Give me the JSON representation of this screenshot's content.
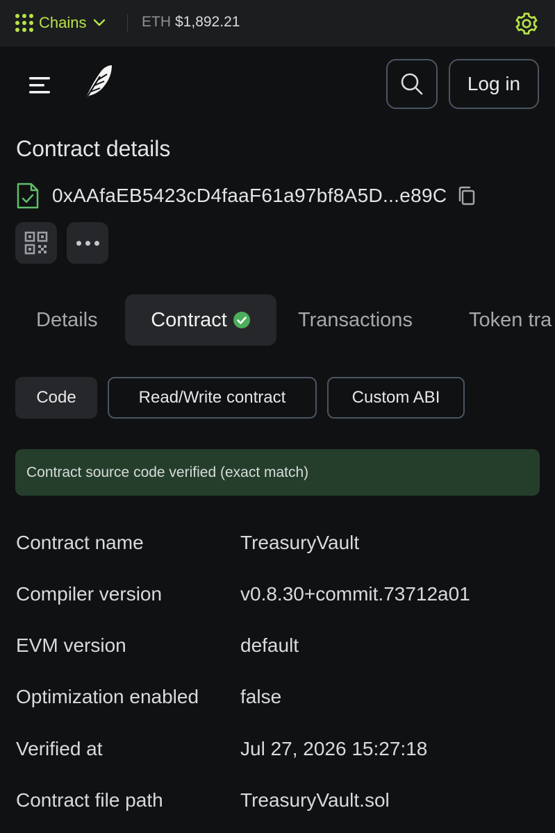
{
  "topbar": {
    "chains_label": "Chains",
    "eth_label": "ETH",
    "eth_price": "$1,892.21",
    "accent_color": "#b7e34a"
  },
  "header": {
    "login_label": "Log in",
    "icons": [
      "menu-icon",
      "feather-logo",
      "search-icon",
      "gear-icon"
    ]
  },
  "page": {
    "title": "Contract details",
    "address": "0xAAfaEB5423cD4faaF61a97bf8A5D...e89C"
  },
  "tabs": [
    {
      "label": "Details"
    },
    {
      "label": "Contract",
      "active": true
    },
    {
      "label": "Transactions"
    },
    {
      "label": "Token tra"
    }
  ],
  "subtabs": [
    {
      "label": "Code",
      "active": true
    },
    {
      "label": "Read/Write contract"
    },
    {
      "label": "Custom ABI"
    }
  ],
  "banner": {
    "text": "Contract source code verified (exact match)",
    "color": "#253e2c"
  },
  "info": [
    {
      "label": "Contract name",
      "value": "TreasuryVault"
    },
    {
      "label": "Compiler version",
      "value": "v0.8.30+commit.73712a01"
    },
    {
      "label": "EVM version",
      "value": "default"
    },
    {
      "label": "Optimization enabled",
      "value": "false"
    },
    {
      "label": "Verified at",
      "value": "Jul 27, 2026 15:27:18"
    },
    {
      "label": "Contract file path",
      "value": "TreasuryVault.sol"
    }
  ]
}
